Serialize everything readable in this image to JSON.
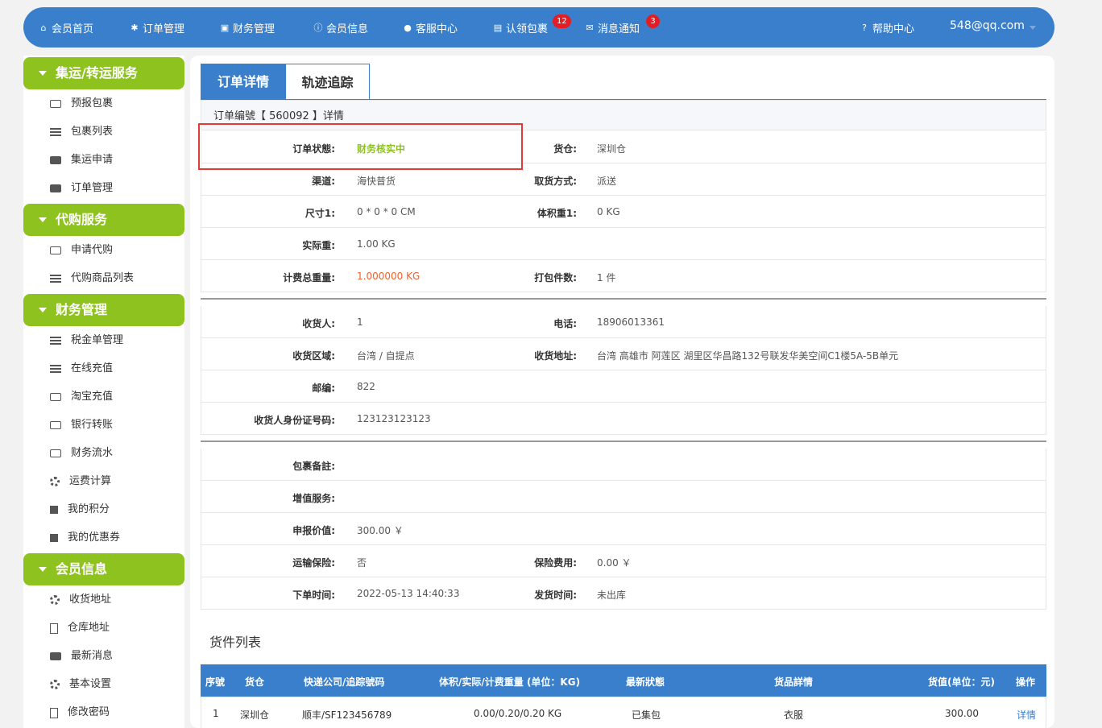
{
  "nav": {
    "items": [
      {
        "label": "会员首页",
        "icon": "home-icon"
      },
      {
        "label": "订单管理",
        "icon": "gear-icon"
      },
      {
        "label": "财务管理",
        "icon": "money-icon"
      },
      {
        "label": "会员信息",
        "icon": "info-icon"
      },
      {
        "label": "客服中心",
        "icon": "user-icon"
      },
      {
        "label": "认领包裹",
        "icon": "archive-icon",
        "badge": "12"
      },
      {
        "label": "消息通知",
        "icon": "envelope-icon",
        "badge": "3"
      }
    ],
    "help": "帮助中心",
    "user": "548@qq.com",
    "badge_color": "#e51c23",
    "bar_color": "#3a7fcb"
  },
  "sidebar": {
    "accent": "#8ec31f",
    "sections": [
      {
        "title": "集运/转运服务",
        "items": [
          "预报包裹",
          "包裹列表",
          "集运申请",
          "订单管理"
        ]
      },
      {
        "title": "代购服务",
        "items": [
          "申请代购",
          "代购商品列表"
        ]
      },
      {
        "title": "财务管理",
        "items": [
          "税金单管理",
          "在线充值",
          "淘宝充值",
          "银行转账",
          "财务流水",
          "运费计算",
          "我的积分",
          "我的优惠券"
        ]
      },
      {
        "title": "会员信息",
        "items": [
          "收货地址",
          "仓库地址",
          "最新消息",
          "基本设置",
          "修改密码"
        ]
      }
    ]
  },
  "tabs": {
    "active": "订单详情",
    "other": "轨迹追踪"
  },
  "order": {
    "header": "订单编號【 560092 】详情",
    "rows1": [
      {
        "l1": "订单状態:",
        "v1": "财务核实中",
        "l2": "货仓:",
        "v2": "深圳仓"
      },
      {
        "l1": "渠道:",
        "v1": "海快普货",
        "l2": "取货方式:",
        "v2": "派送"
      },
      {
        "l1": "尺寸1:",
        "v1": "0 * 0 * 0 CM",
        "l2": "体积重1:",
        "v2": "0 KG"
      },
      {
        "l1": "实际重:",
        "v1": "1.00 KG",
        "l2": "",
        "v2": ""
      },
      {
        "l1": "计费总重量:",
        "v1": "1.000000 KG",
        "l2": "打包件数:",
        "v2": "1 件"
      }
    ],
    "rows2": [
      {
        "l1": "收货人:",
        "v1": "1",
        "l2": "电话:",
        "v2": "18906013361"
      },
      {
        "l1": "收货区域:",
        "v1": "台湾 / 自提点",
        "l2": "收货地址:",
        "v2": "台湾 高雄市 阿莲区 湖里区华昌路132号联发华美空间C1楼5A-5B单元"
      },
      {
        "l1": "邮编:",
        "v1": "822",
        "l2": "",
        "v2": ""
      },
      {
        "l1": "收货人身份证号码:",
        "v1": "123123123123",
        "l2": "",
        "v2": ""
      }
    ],
    "rows3": [
      {
        "l1": "包裹备註:",
        "v1": "",
        "l2": "",
        "v2": ""
      },
      {
        "l1": "增值服务:",
        "v1": "",
        "l2": "",
        "v2": ""
      },
      {
        "l1": "申报价值:",
        "v1": "300.00 ￥",
        "l2": "",
        "v2": ""
      },
      {
        "l1": "运输保险:",
        "v1": "否",
        "l2": "保险费用:",
        "v2": "0.00 ￥"
      },
      {
        "l1": "下单时间:",
        "v1": "2022-05-13 14:40:33",
        "l2": "发货时间:",
        "v2": "未出库"
      }
    ]
  },
  "goods": {
    "title": "货件列表",
    "headers": [
      "序號",
      "货仓",
      "快递公司/追踪號码",
      "体积/实际/计费重量 (单位：KG)",
      "最新狀態",
      "货品詳情",
      "货值(单位：元)",
      "操作"
    ],
    "rows": [
      [
        "1",
        "深圳仓",
        "顺丰/SF123456789",
        "0.00/0.20/0.20 KG",
        "已集包",
        "衣服",
        "300.00",
        "详情"
      ]
    ]
  }
}
